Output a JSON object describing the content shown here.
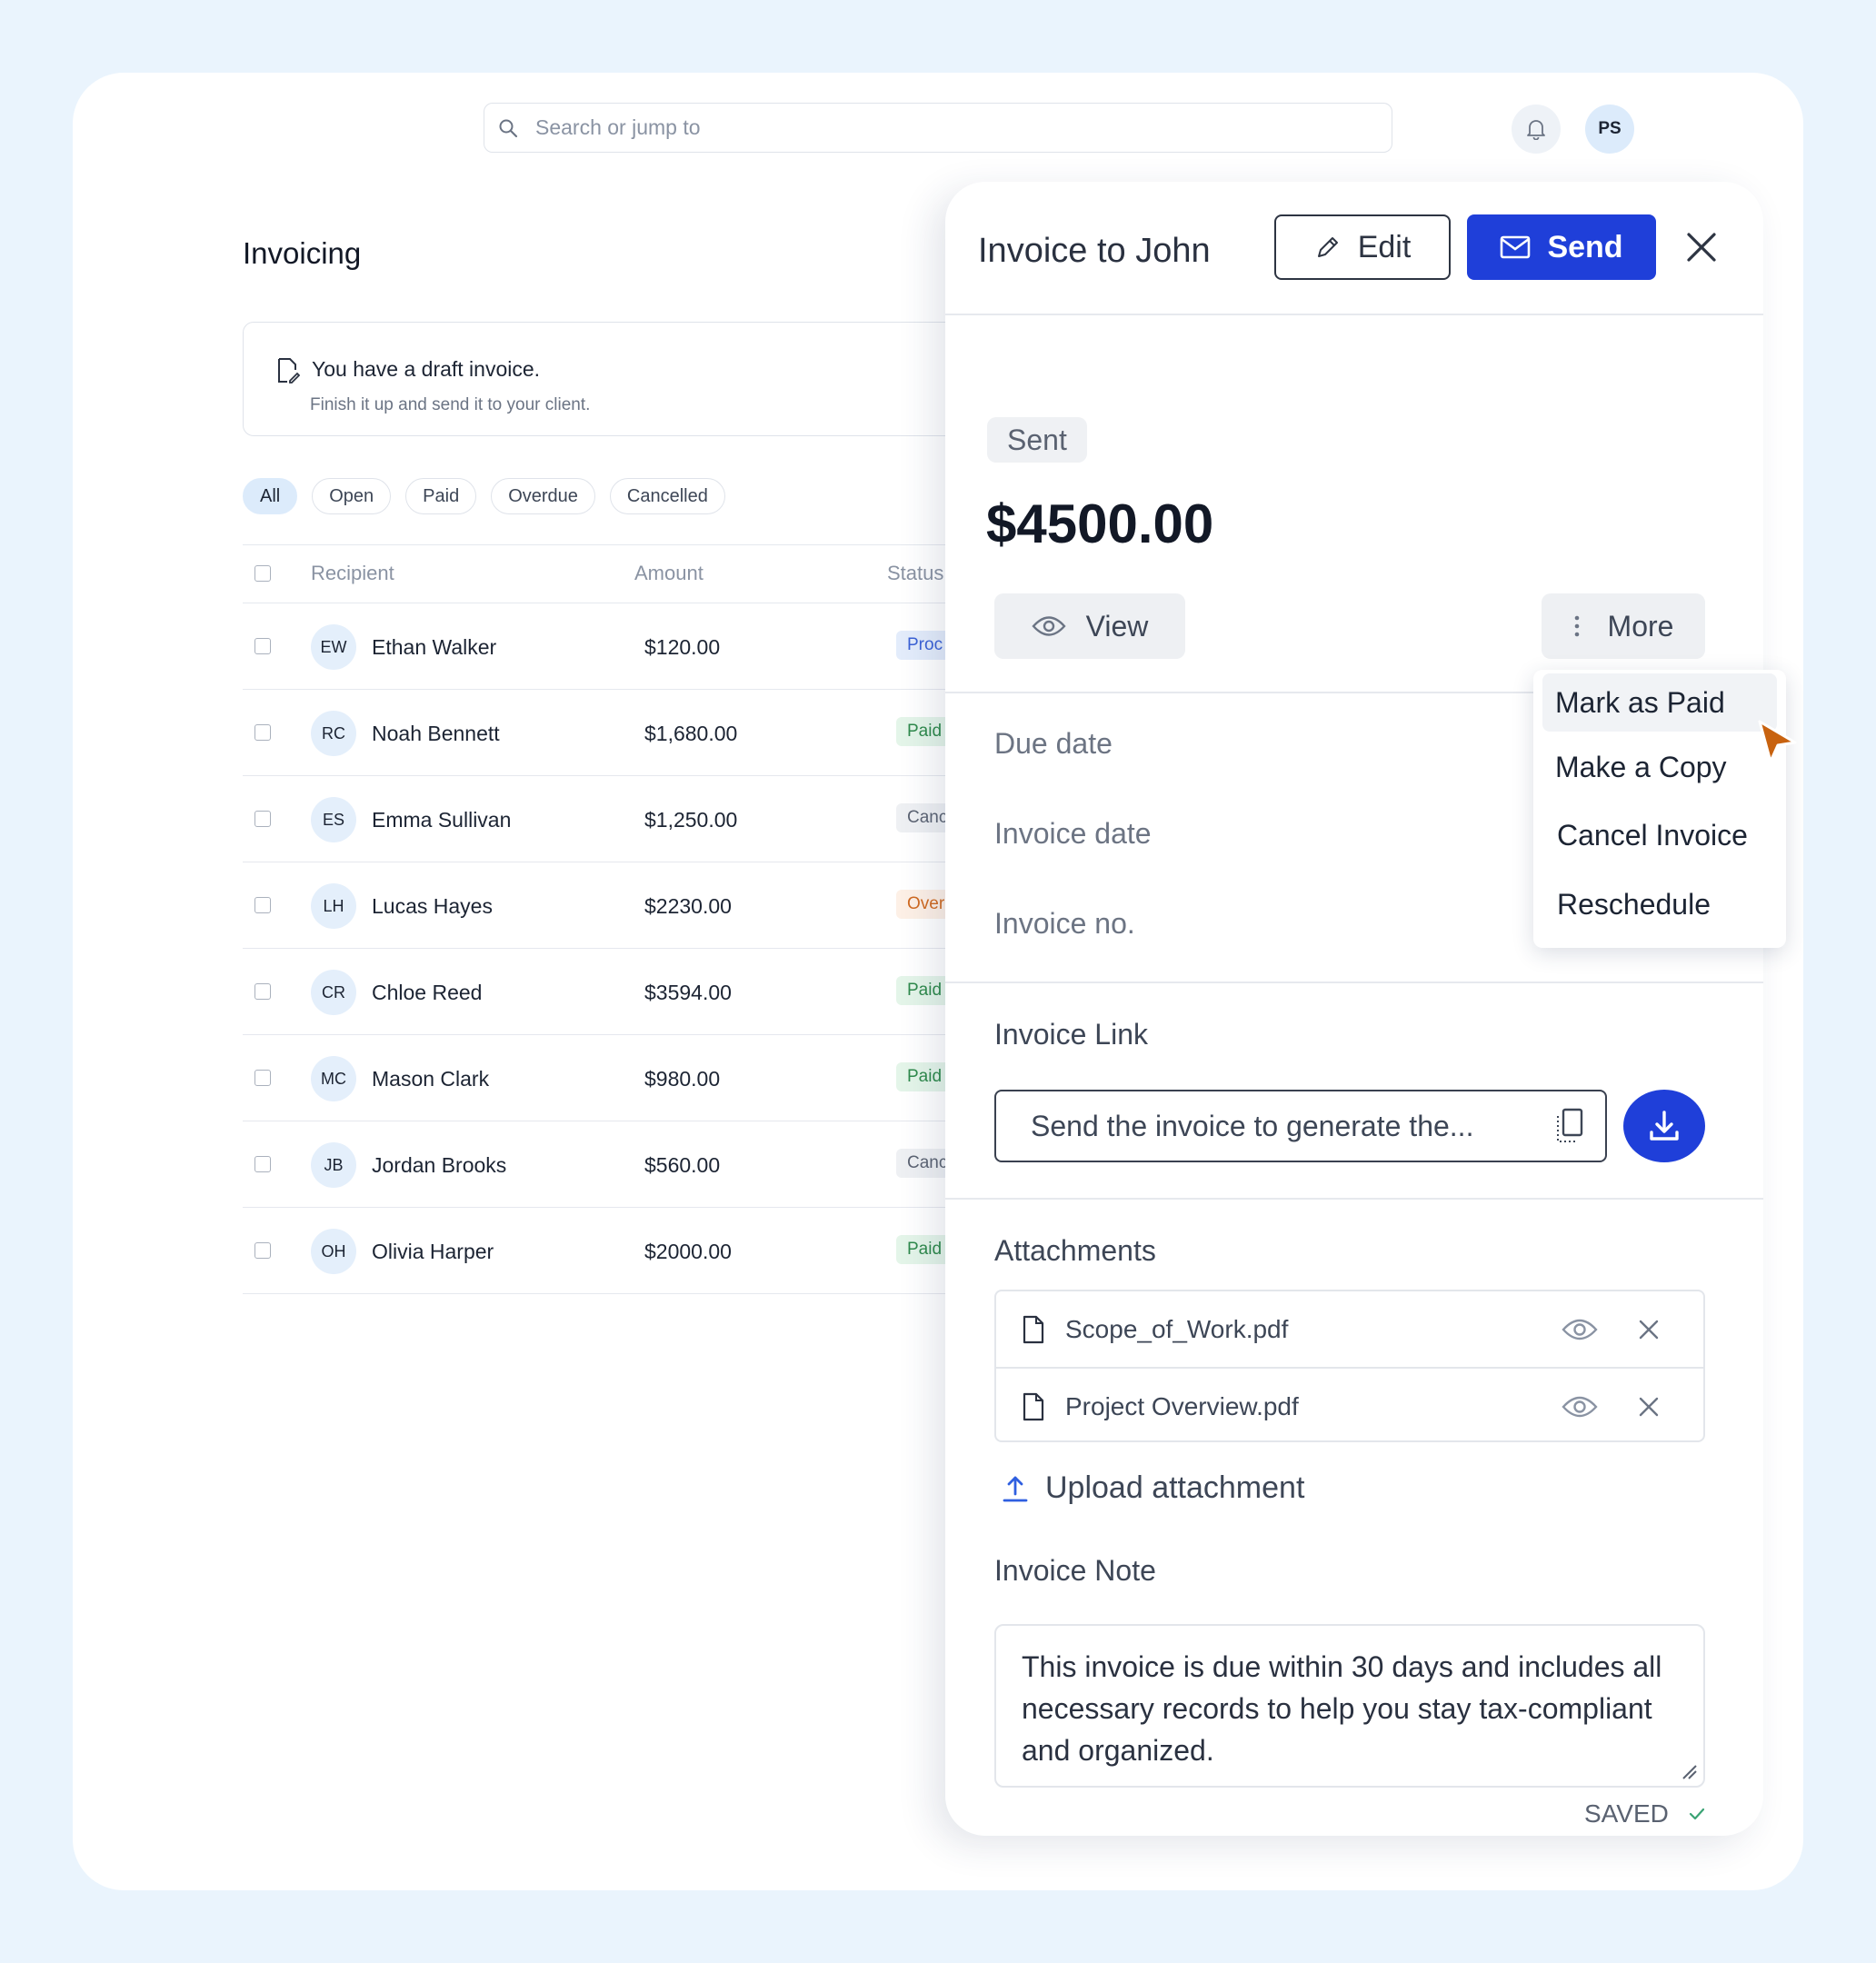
{
  "topbar": {
    "search_placeholder": "Search or jump to",
    "avatar_initials": "PS"
  },
  "page": {
    "title": "Invoicing",
    "draft": {
      "title": "You have a draft invoice.",
      "subtitle": "Finish it up and send it to your client."
    },
    "filters": [
      "All",
      "Open",
      "Paid",
      "Overdue",
      "Cancelled"
    ],
    "active_filter": "All",
    "table": {
      "headers": {
        "recipient": "Recipient",
        "amount": "Amount",
        "status": "Status"
      },
      "rows": [
        {
          "initials": "EW",
          "name": "Ethan Walker",
          "amount": "$120.00",
          "status": "Proc"
        },
        {
          "initials": "RC",
          "name": "Noah Bennett",
          "amount": "$1,680.00",
          "status": "Paid"
        },
        {
          "initials": "ES",
          "name": "Emma Sullivan",
          "amount": "$1,250.00",
          "status": "Canc"
        },
        {
          "initials": "LH",
          "name": "Lucas Hayes",
          "amount": "$2230.00",
          "status": "Over"
        },
        {
          "initials": "CR",
          "name": "Chloe Reed",
          "amount": "$3594.00",
          "status": "Paid"
        },
        {
          "initials": "MC",
          "name": "Mason Clark",
          "amount": "$980.00",
          "status": "Paid"
        },
        {
          "initials": "JB",
          "name": "Jordan Brooks",
          "amount": "$560.00",
          "status": "Canc"
        },
        {
          "initials": "OH",
          "name": "Olivia Harper",
          "amount": "$2000.00",
          "status": "Paid"
        }
      ]
    }
  },
  "panel": {
    "title": "Invoice to John",
    "edit_label": "Edit",
    "send_label": "Send",
    "status": "Sent",
    "amount": "$4500.00",
    "view_label": "View",
    "more_label": "More",
    "fields": {
      "due_date": "Due date",
      "invoice_date": "Invoice date",
      "invoice_no": "Invoice no."
    },
    "invoice_link": {
      "label": "Invoice Link",
      "placeholder": "Send the invoice to generate the..."
    },
    "attachments": {
      "label": "Attachments",
      "files": [
        "Scope_of_Work.pdf",
        "Project Overview.pdf"
      ],
      "upload_label": "Upload attachment"
    },
    "note": {
      "label": "Invoice Note",
      "text": "This invoice is due within 30 days and includes all necessary records to help you stay tax-compliant and organized.",
      "saved_label": "SAVED"
    }
  },
  "more_menu": {
    "items": [
      "Mark as Paid",
      "Make a Copy",
      "Cancel Invoice",
      "Reschedule"
    ],
    "highlighted": "Mark as Paid"
  },
  "colors": {
    "accent": "#1f3fd9",
    "background": "#eaf4fd",
    "cursor": "#c8620f",
    "paid": "#2f8a4c",
    "overdue": "#d06a21"
  }
}
